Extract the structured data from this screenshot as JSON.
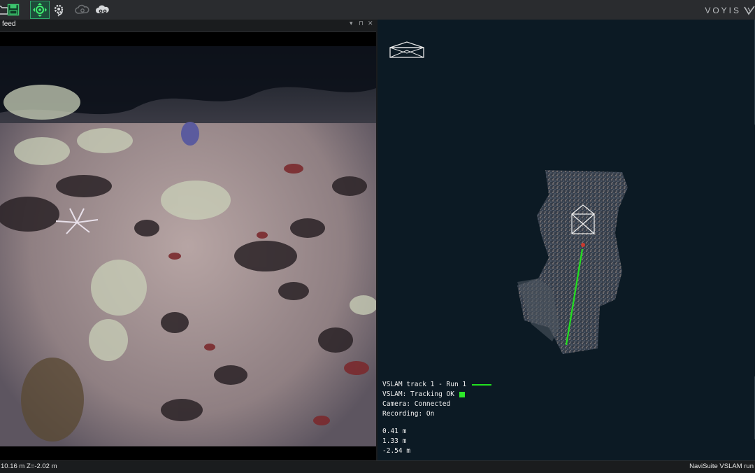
{
  "toolbar": {
    "logo_text": "VOYIS",
    "buttons": [
      {
        "icon": "folder-icon"
      },
      {
        "icon": "save-icon"
      },
      {
        "icon": "navigation-target-icon",
        "active": true
      },
      {
        "icon": "gear-sync-icon"
      },
      {
        "icon": "cloud-sync-icon",
        "disabled": true
      },
      {
        "icon": "cloud-settings-icon"
      }
    ]
  },
  "camera_panel": {
    "title": "feed",
    "controls": [
      "▾",
      "⊓",
      "✕"
    ]
  },
  "viewer": {
    "track_label": "VSLAM track 1 - Run 1",
    "tracking_status": "VSLAM: Tracking OK",
    "camera_status": "Camera: Connected",
    "recording_status": "Recording: On",
    "coordinates": [
      "0.41 m",
      "1.33 m",
      "-2.54 m"
    ],
    "colors": {
      "track": "#22e01f",
      "status_ok": "#2ee82a",
      "background": "#0c1a24"
    }
  },
  "status_bar": {
    "left_text": "10.16 m Z=-2.02 m",
    "right_text": "NaviSuite VSLAM run"
  }
}
